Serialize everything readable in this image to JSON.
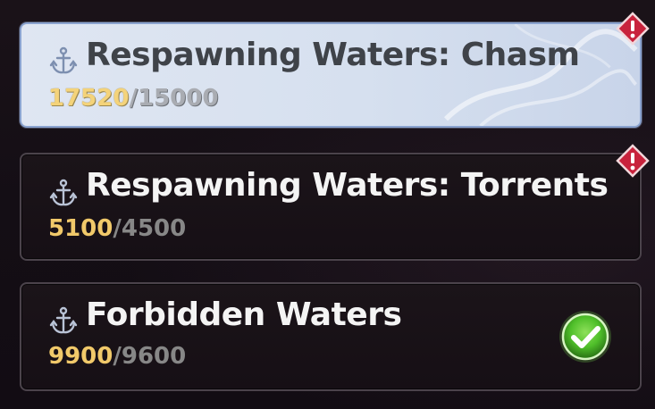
{
  "quests": [
    {
      "title": "Respawning Waters: Chasm",
      "current": "17520",
      "separator": "/",
      "required": "15000",
      "state": "selected",
      "status_icon": "alert-icon"
    },
    {
      "title": "Respawning Waters: Torrents",
      "current": "5100",
      "separator": "/",
      "required": "4500",
      "state": "normal",
      "status_icon": "alert-icon"
    },
    {
      "title": "Forbidden Waters",
      "current": "9900",
      "separator": "/",
      "required": "9600",
      "state": "normal",
      "status_icon": "checkmark-icon"
    }
  ],
  "colors": {
    "selected_bg": "#d6e0ef",
    "progress_current": "#f1c96a",
    "alert_red": "#c8223c",
    "check_green": "#4fbf2a"
  }
}
